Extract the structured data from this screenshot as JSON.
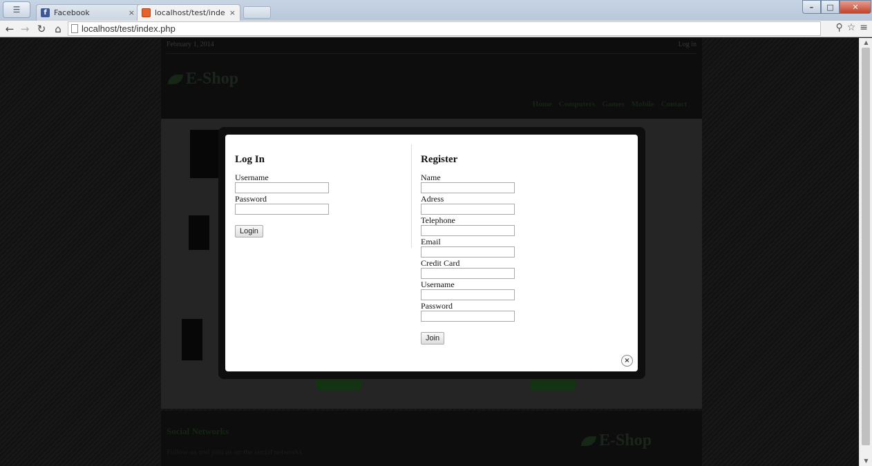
{
  "browser": {
    "tabs": [
      {
        "title": "Facebook",
        "active": false
      },
      {
        "title": "localhost/test/index.php",
        "active": true
      }
    ],
    "tab_close_glyph": "×",
    "url": "localhost/test/index.php",
    "window_controls": {
      "minimize": "–",
      "maximize": "□",
      "close": "✕"
    }
  },
  "site": {
    "date": "February 1, 2014",
    "login_link": "Log in",
    "logo": "E-Shop",
    "nav": [
      "Home",
      "Computers",
      "Games",
      "Mobile",
      "Contact"
    ],
    "footer_title": "Social Networks",
    "footer_text": "Follow us and join us on the social networks",
    "footer_logo": "E-Shop"
  },
  "modal": {
    "login": {
      "title": "Log In",
      "fields": [
        "Username",
        "Password"
      ],
      "button": "Login"
    },
    "register": {
      "title": "Register",
      "fields": [
        "Name",
        "Adress",
        "Telephone",
        "Email",
        "Credit Card",
        "Username",
        "Password"
      ],
      "button": "Join"
    },
    "close_glyph": "×"
  }
}
